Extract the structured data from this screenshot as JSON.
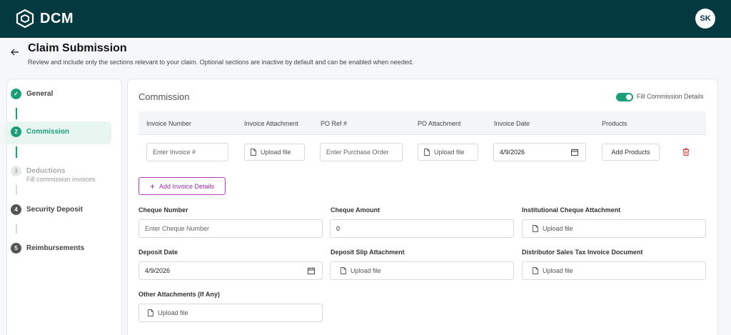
{
  "header": {
    "app_name": "DCM",
    "avatar_initials": "SK"
  },
  "page": {
    "title": "Claim Submission",
    "subtitle": "Review and include only the sections relevant to your claim. Optional sections are inactive by default and can be enabled when needed."
  },
  "steps": [
    {
      "number": "✓",
      "label": "General",
      "state": "done"
    },
    {
      "number": "2",
      "label": "Commission",
      "state": "active"
    },
    {
      "number": "3",
      "label": "Deductions",
      "sub": "Fill commission invoices",
      "state": "disabled"
    },
    {
      "number": "4",
      "label": "Security Deposit",
      "state": "pending"
    },
    {
      "number": "5",
      "label": "Reimbursements",
      "state": "pending"
    }
  ],
  "commission": {
    "title": "Commission",
    "toggle_label": "Fill Commission Details",
    "toggle_on": true,
    "columns": [
      "Invoice Number",
      "Invoice Attachment",
      "PO Ref #",
      "PO Attachment",
      "Invoice Date",
      "Products"
    ],
    "row": {
      "invoice_number_placeholder": "Enter Invoice #",
      "invoice_attachment": "Upload file",
      "po_ref_placeholder": "Enter Purchase Order",
      "po_attachment": "Upload file",
      "invoice_date": "4/9/2026",
      "products_button": "Add Products"
    },
    "add_invoice_button": "Add Invoice Details"
  },
  "cheque": {
    "number_label": "Cheque Number",
    "number_placeholder": "Enter Cheque Number",
    "amount_label": "Cheque Amount",
    "amount_value": "0",
    "inst_attachment_label": "Institutional Cheque Attachment",
    "inst_attachment": "Upload file"
  },
  "deposit": {
    "date_label": "Deposit Date",
    "date_value": "4/9/2026",
    "slip_label": "Deposit Slip Attachment",
    "slip_attachment": "Upload file",
    "tax_label": "Distributor Sales Tax Invoice Document",
    "tax_attachment": "Upload file"
  },
  "other": {
    "label": "Other Attachments (If Any)",
    "attachment": "Upload file"
  },
  "colors": {
    "header_bg": "#04393f",
    "accent_green": "#1c9f79",
    "accent_purple": "#9b2aa3",
    "danger": "#d32f2f"
  }
}
